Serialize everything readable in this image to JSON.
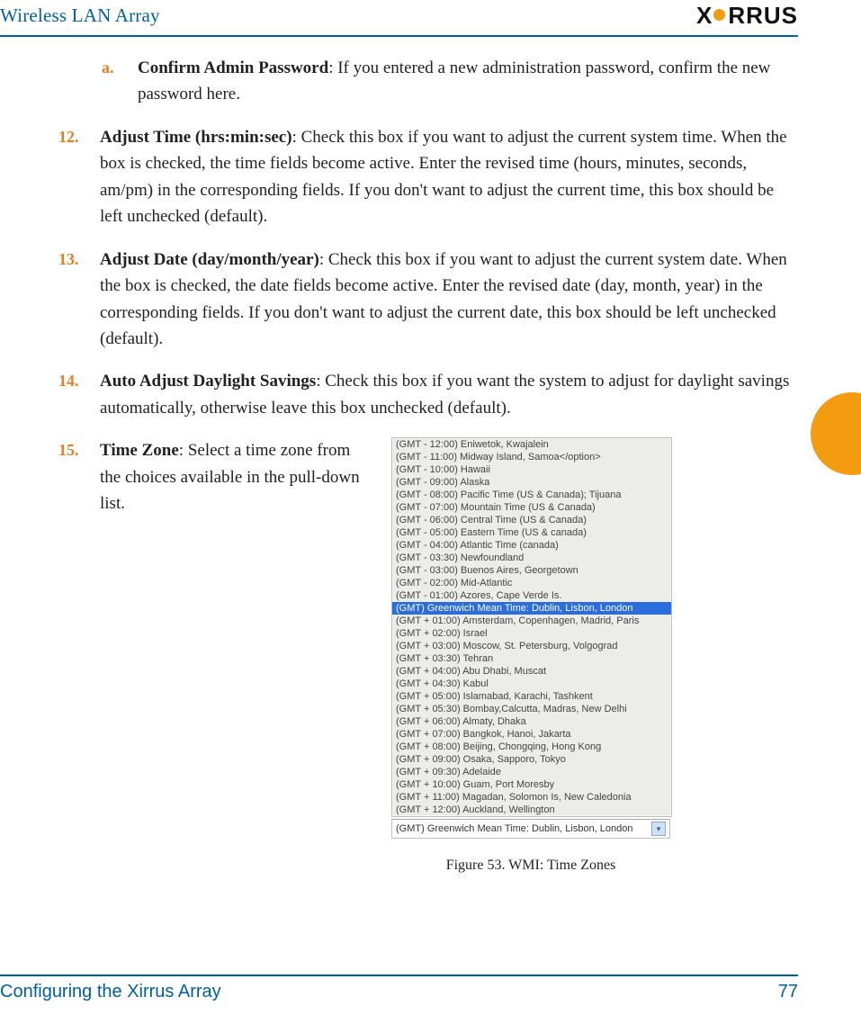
{
  "header": {
    "title": "Wireless LAN Array",
    "brand": "XIRRUS"
  },
  "list": {
    "a": {
      "num": "a.",
      "lead": "Confirm Admin Password",
      "rest": ": If you entered a new administration password, confirm the new password here."
    },
    "i12": {
      "num": "12.",
      "lead": "Adjust Time (hrs:min:sec)",
      "rest": ": Check this box if you want to adjust the current system time. When the box is checked, the time fields become active. Enter the revised time (hours, minutes, seconds, am/pm) in the corresponding fields. If you don't want to adjust the current time, this box should be left unchecked (default)."
    },
    "i13": {
      "num": "13.",
      "lead": "Adjust Date (day/month/year)",
      "rest": ": Check this box if you want to adjust the current system date. When the box is checked, the date fields become active. Enter the revised date (day, month, year) in the corresponding fields. If you don't want to adjust the current date, this box should be left unchecked (default)."
    },
    "i14": {
      "num": "14.",
      "lead": "Auto Adjust Daylight Savings",
      "rest": ": Check this box if you want the system to adjust for daylight savings automatically, otherwise leave this box unchecked (default)."
    },
    "i15": {
      "num": "15.",
      "lead": "Time Zone",
      "rest": ": Select a time zone from the choices available in the pull-down list."
    }
  },
  "timezones": {
    "options": {
      "o0": "(GMT - 12:00) Eniwetok, Kwajalein",
      "o1": "(GMT - 11:00) Midway Island, Samoa</option>",
      "o2": "(GMT - 10:00) Hawaii",
      "o3": "(GMT - 09:00) Alaska",
      "o4": "(GMT - 08:00) Pacific Time (US & Canada); Tijuana",
      "o5": "(GMT - 07:00) Mountain Time (US & Canada)",
      "o6": "(GMT - 06:00) Central Time (US & Canada)",
      "o7": "(GMT - 05:00) Eastern Time (US & canada)",
      "o8": "(GMT - 04:00) Atlantic Time (canada)",
      "o9": "(GMT - 03:30) Newfoundland",
      "o10": "(GMT - 03:00) Buenos Aires, Georgetown",
      "o11": "(GMT - 02:00) Mid-Atlantic",
      "o12": "(GMT - 01:00) Azores, Cape Verde Is.",
      "sel": "(GMT) Greenwich Mean Time: Dublin, Lisbon, London",
      "o14": "(GMT + 01:00) Amsterdam, Copenhagen, Madrid, Paris",
      "o15": "(GMT + 02:00) Israel",
      "o16": "(GMT + 03:00) Moscow, St. Petersburg, Volgograd",
      "o17": "(GMT + 03:30) Tehran",
      "o18": "(GMT + 04:00) Abu Dhabi, Muscat",
      "o19": "(GMT + 04:30) Kabul",
      "o20": "(GMT + 05:00) Islamabad, Karachi, Tashkent",
      "o21": "(GMT + 05:30) Bombay,Calcutta, Madras, New Delhi",
      "o22": "(GMT + 06:00) Almaty, Dhaka",
      "o23": "(GMT + 07:00) Bangkok, Hanoi, Jakarta",
      "o24": "(GMT + 08:00) Beijing, Chongqing, Hong Kong",
      "o25": "(GMT + 09:00) Osaka, Sapporo, Tokyo",
      "o26": "(GMT + 09:30) Adelaide",
      "o27": "(GMT + 10:00) Guam, Port Moresby",
      "o28": "(GMT + 11:00) Magadan, Solomon Is, New Caledonia",
      "o29": "(GMT + 12:00) Auckland, Wellington"
    },
    "footer": "(GMT) Greenwich Mean Time: Dublin, Lisbon, London",
    "caption": "Figure 53. WMI: Time Zones"
  },
  "footer": {
    "section": "Configuring the Xirrus Array",
    "page": "77"
  }
}
